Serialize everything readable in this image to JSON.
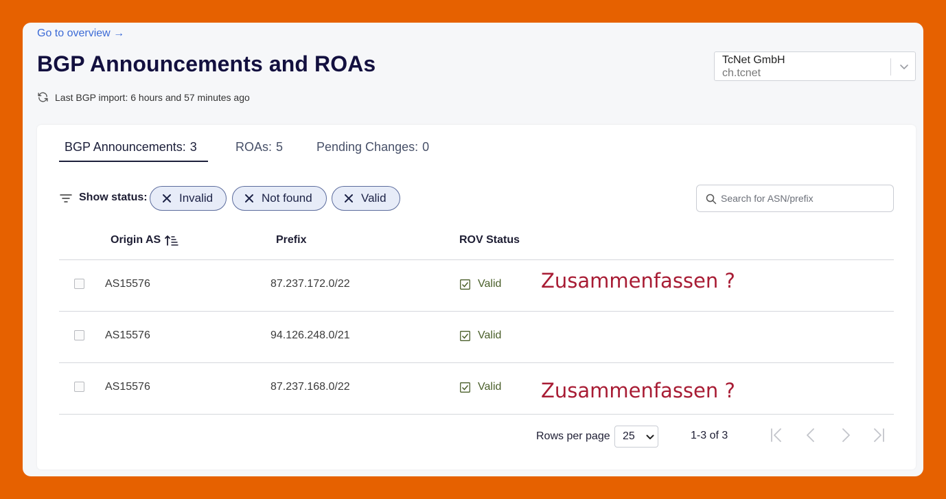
{
  "nav": {
    "overview_link": "Go to overview →"
  },
  "header": {
    "title": "BGP Announcements and ROAs",
    "import_status": "Last BGP import: 6 hours and 57 minutes ago"
  },
  "org_selector": {
    "name": "TcNet GmbH",
    "handle": "ch.tcnet"
  },
  "tabs": [
    {
      "label": "BGP Announcements:",
      "count": "3"
    },
    {
      "label": "ROAs:",
      "count": "5"
    },
    {
      "label": "Pending Changes:",
      "count": "0"
    }
  ],
  "filter": {
    "label": "Show status:",
    "chips": [
      "Invalid",
      "Not found",
      "Valid"
    ]
  },
  "search": {
    "placeholder": "Search for ASN/prefix",
    "value": ""
  },
  "table": {
    "columns": [
      "Origin AS",
      "Prefix",
      "ROV Status"
    ],
    "rows": [
      {
        "origin": "AS15576",
        "prefix": "87.237.172.0/22",
        "status": "Valid",
        "annotation": "Zusammenfassen ?"
      },
      {
        "origin": "AS15576",
        "prefix": "94.126.248.0/21",
        "status": "Valid",
        "annotation": ""
      },
      {
        "origin": "AS15576",
        "prefix": "87.237.168.0/22",
        "status": "Valid",
        "annotation": "Zusammenfassen ?"
      }
    ]
  },
  "pagination": {
    "rows_per_page_label": "Rows per page",
    "rows_per_page": "25",
    "range": "1-3 of 3"
  },
  "colors": {
    "background": "#e66100",
    "title": "#13103f",
    "link": "#3c6bd6",
    "chip_fill": "#e7ecf8",
    "valid_text": "#4a5f2a",
    "annotation": "#a81c34"
  }
}
